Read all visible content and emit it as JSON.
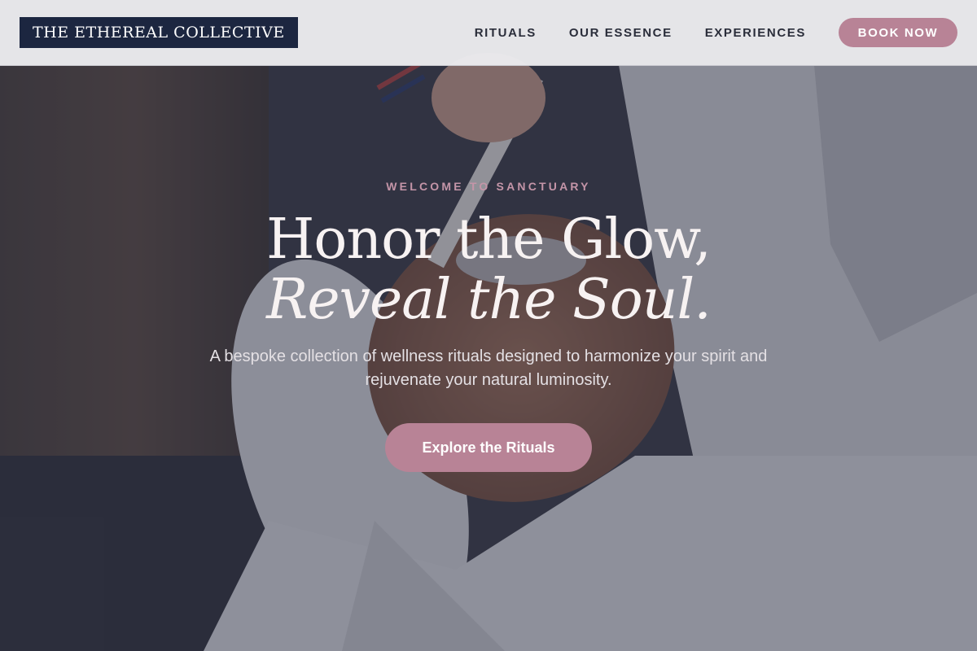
{
  "header": {
    "logo_text": "THE ETHEREAL COLLECTIVE",
    "nav": [
      {
        "label": "RITUALS"
      },
      {
        "label": "OUR ESSENCE"
      },
      {
        "label": "EXPERIENCES"
      }
    ],
    "book_label": "BOOK NOW"
  },
  "hero": {
    "background_image": "spa-facial-treatment-photo",
    "eyebrow": "WELCOME TO SANCTUARY",
    "headline_line1": "Honor the Glow,",
    "headline_line2": "Reveal the Soul.",
    "subhead": "A bespoke collection of wellness rituals designed to harmonize your spirit and rejuvenate your natural luminosity.",
    "cta_label": "Explore the Rituals"
  },
  "colors": {
    "brand_navy": "#1c2640",
    "accent_rose": "#b88396",
    "eyebrow_rose": "#c495a8",
    "header_bg": "#ececef",
    "headline": "#f7f2f2"
  }
}
